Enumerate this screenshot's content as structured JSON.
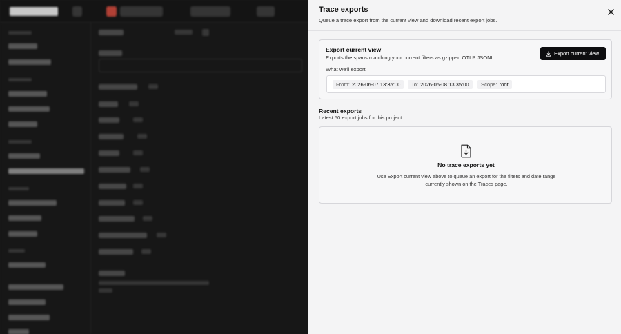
{
  "drawer": {
    "title": "Trace exports",
    "subtitle": "Queue a trace export from the current view and download recent export jobs."
  },
  "export_card": {
    "title": "Export current view",
    "description": "Exports the spans matching your current filters as gzipped OTLP JSONL.",
    "what_label": "What we'll export",
    "button_label": "Export current view",
    "button_icon": "download-icon",
    "range": {
      "from_label": "From:",
      "from_value": "2026-06-07 13:35:00",
      "to_label": "To:",
      "to_value": "2026-06-08 13:35:00",
      "scope_label": "Scope:",
      "scope_value": "root"
    }
  },
  "recent": {
    "title": "Recent exports",
    "subtitle": "Latest 50 export jobs for this project.",
    "empty_icon": "file-download-icon",
    "empty_title": "No trace exports yet",
    "empty_desc": "Use Export current view above to queue an export for the filters and date range currently shown on the Traces page."
  },
  "colors": {
    "accent": "#0d0d0f",
    "drawer_bg": "#f4f4f5",
    "background_app": "#191919"
  }
}
